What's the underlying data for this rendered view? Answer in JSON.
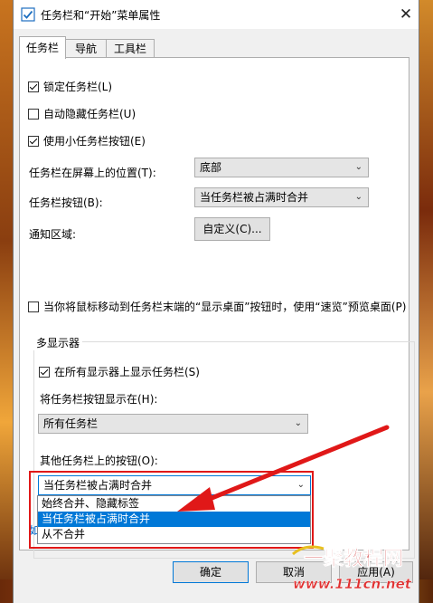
{
  "window": {
    "title": "任务栏和“开始”菜单属性",
    "close_symbol": "✕"
  },
  "tabs": [
    {
      "label": "任务栏",
      "active": true
    },
    {
      "label": "导航",
      "active": false
    },
    {
      "label": "工具栏",
      "active": false
    }
  ],
  "options": {
    "lock_taskbar": {
      "label": "锁定任务栏(L)",
      "checked": true
    },
    "auto_hide": {
      "label": "自动隐藏任务栏(U)",
      "checked": false
    },
    "small_buttons": {
      "label": "使用小任务栏按钮(E)",
      "checked": true
    }
  },
  "position": {
    "label": "任务栏在屏幕上的位置(T):",
    "value": "底部"
  },
  "buttons_mode": {
    "label": "任务栏按钮(B):",
    "value": "当任务栏被占满时合并"
  },
  "notify_area": {
    "label": "通知区域:",
    "button": "自定义(C)..."
  },
  "peek": {
    "label": "当你将鼠标移动到任务栏末端的“显示桌面”按钮时，使用“速览”预览桌面(P)",
    "checked": false
  },
  "multi_display": {
    "group_title": "多显示器",
    "show_all": {
      "label": "在所有显示器上显示任务栏(S)",
      "checked": true
    },
    "show_buttons_on_label": "将任务栏按钮显示在(H):",
    "show_buttons_on_value": "所有任务栏",
    "other_buttons_label": "其他任务栏上的按钮(O):",
    "other_buttons_value": "当任务栏被占满时合并",
    "dropdown_options": [
      "始终合并、隐藏标签",
      "当任务栏被占满时合并",
      "从不合并"
    ],
    "dropdown_selected_index": 1
  },
  "link_fragment": "如",
  "footer": {
    "ok": "确定",
    "cancel": "取消",
    "apply": "应用(A)"
  },
  "watermark": {
    "brand": "一聚教程网",
    "url": "www.111cn.net"
  },
  "colors": {
    "accent": "#0078d7",
    "annotation_red": "#e01818"
  }
}
